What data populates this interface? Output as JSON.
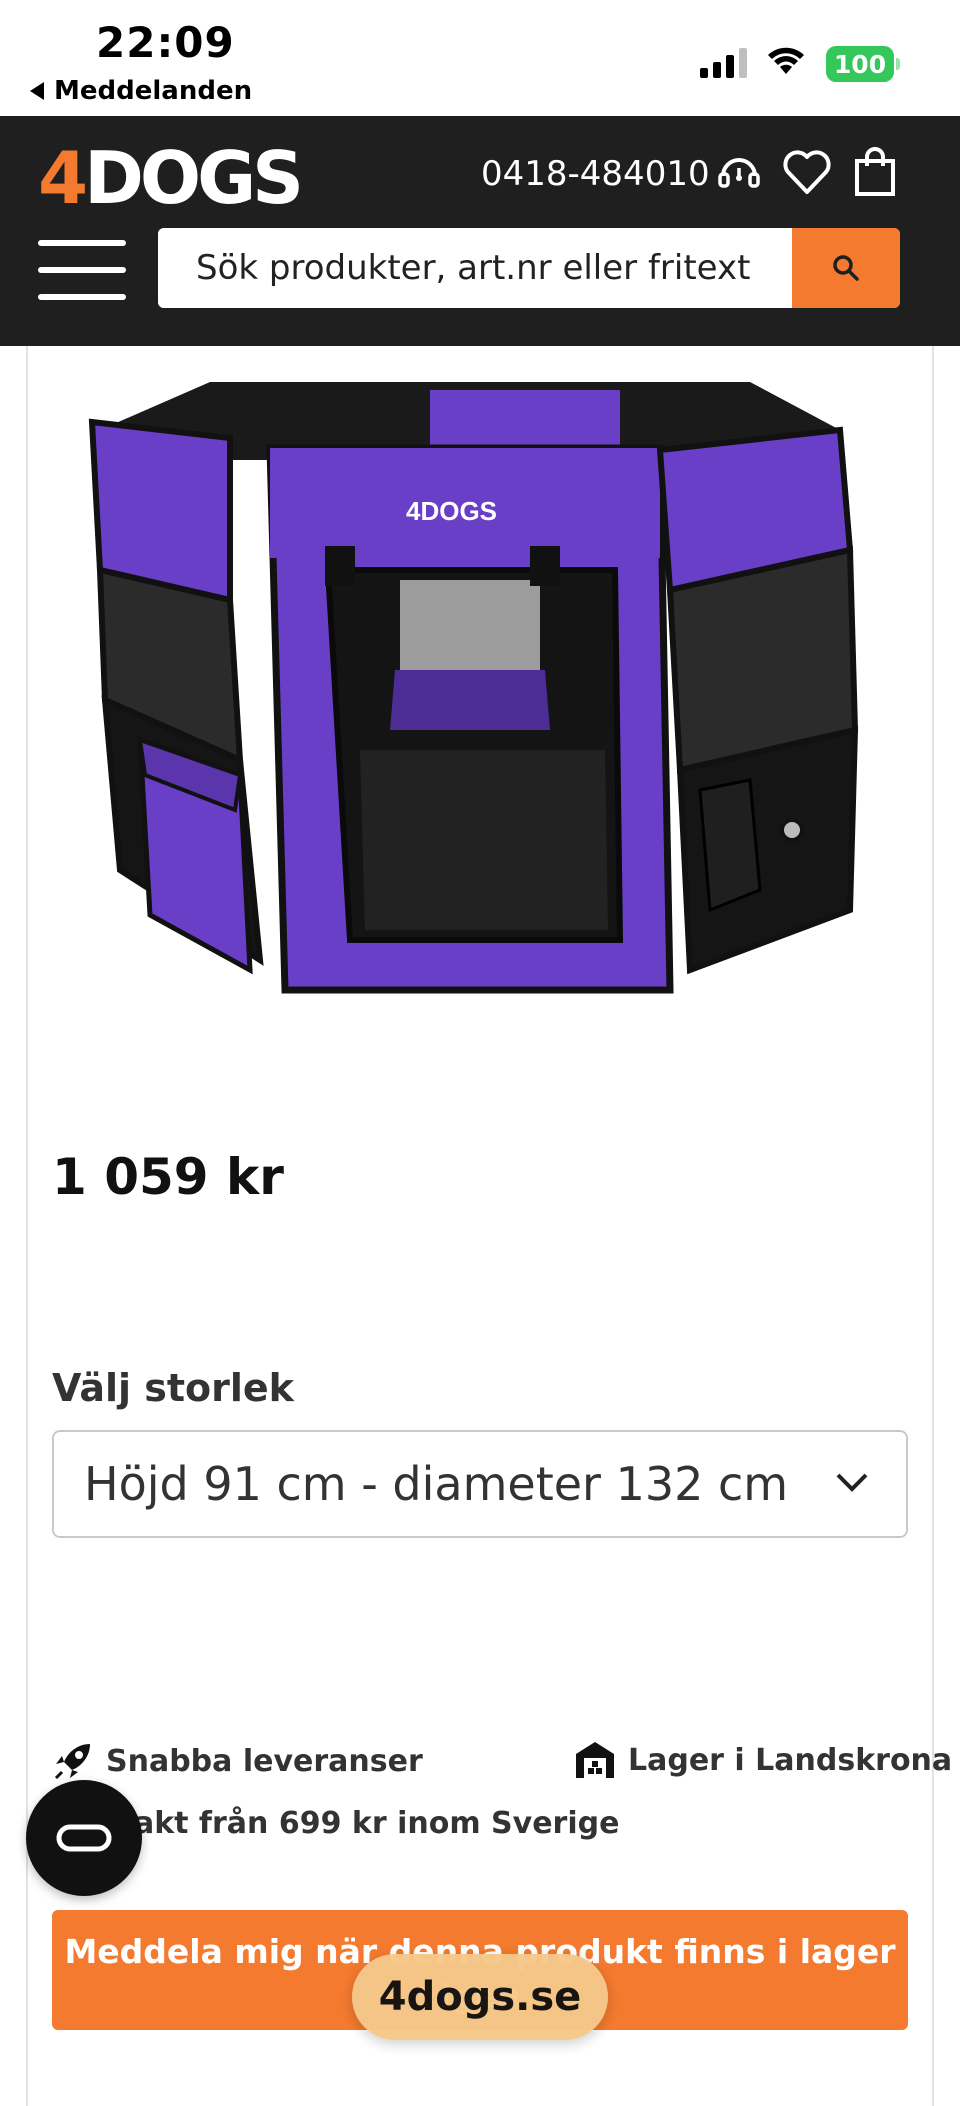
{
  "status_bar": {
    "time": "22:09",
    "back_label": "Meddelanden",
    "battery": "100"
  },
  "header": {
    "logo_four": "4",
    "logo_text": "DOGS",
    "phone": "0418-484010",
    "search_placeholder": "Sök produkter, art.nr eller fritext",
    "icons": [
      "support-icon",
      "heart-icon",
      "cart-icon",
      "search-icon",
      "menu-icon"
    ]
  },
  "product": {
    "price": "1 059 kr",
    "size_label": "Välj storlek",
    "size_selected": "Höjd 91 cm - diameter 132 cm",
    "image_logo": "4DOGS"
  },
  "usps": {
    "fast_delivery": "Snabba leveranser",
    "warehouse": "Lager i Landskrona",
    "free_shipping": "Fri frakt från 699 kr inom Sverige"
  },
  "notify_button": {
    "label": "Meddela mig när denna produkt finns i lager igen"
  },
  "url_bar": {
    "domain": "4dogs.se"
  },
  "colors": {
    "brand_orange": "#f47a2f",
    "header_bg": "#1f1f1f",
    "product_purple": "#6a3fc8"
  }
}
